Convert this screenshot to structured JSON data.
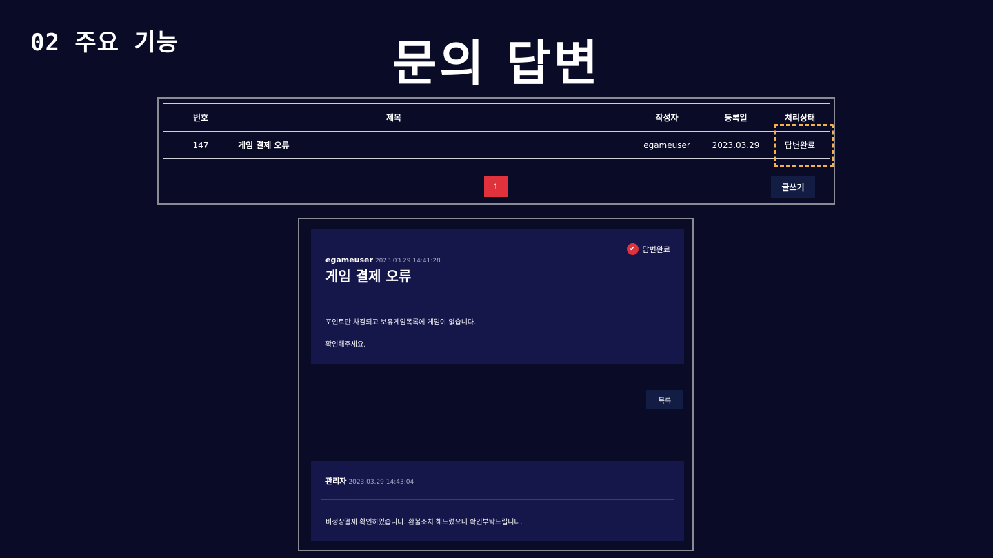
{
  "section_label": "02 주요 기능",
  "page_title": "문의 답변",
  "board": {
    "columns": {
      "num": "번호",
      "title": "제목",
      "author": "작성자",
      "date": "등록일",
      "status": "처리상태"
    },
    "rows": [
      {
        "num": "147",
        "title": "게임 결제 오류",
        "author": "egameuser",
        "date": "2023.03.29",
        "status": "답변완료"
      }
    ],
    "current_page": "1",
    "write_label": "글쓰기"
  },
  "detail": {
    "author": "egameuser",
    "datetime": "2023.03.29 14:41:28",
    "status": "답변완료",
    "title": "게임 결제 오류",
    "body": [
      "포인트만 차감되고 보유게임목록에 게임이 없습니다.",
      "확인해주세요."
    ],
    "list_label": "목록"
  },
  "reply": {
    "author": "관리자",
    "datetime": "2023.03.29 14:43:04",
    "body": "비정상결제 확인하였습니다. 환불조치 해드렸으니 확인부탁드립니다."
  },
  "colors": {
    "background": "#0a0b27",
    "card": "#15164a",
    "accent_red": "#e0323c",
    "highlight": "#f4b24b",
    "button": "#131d44"
  }
}
